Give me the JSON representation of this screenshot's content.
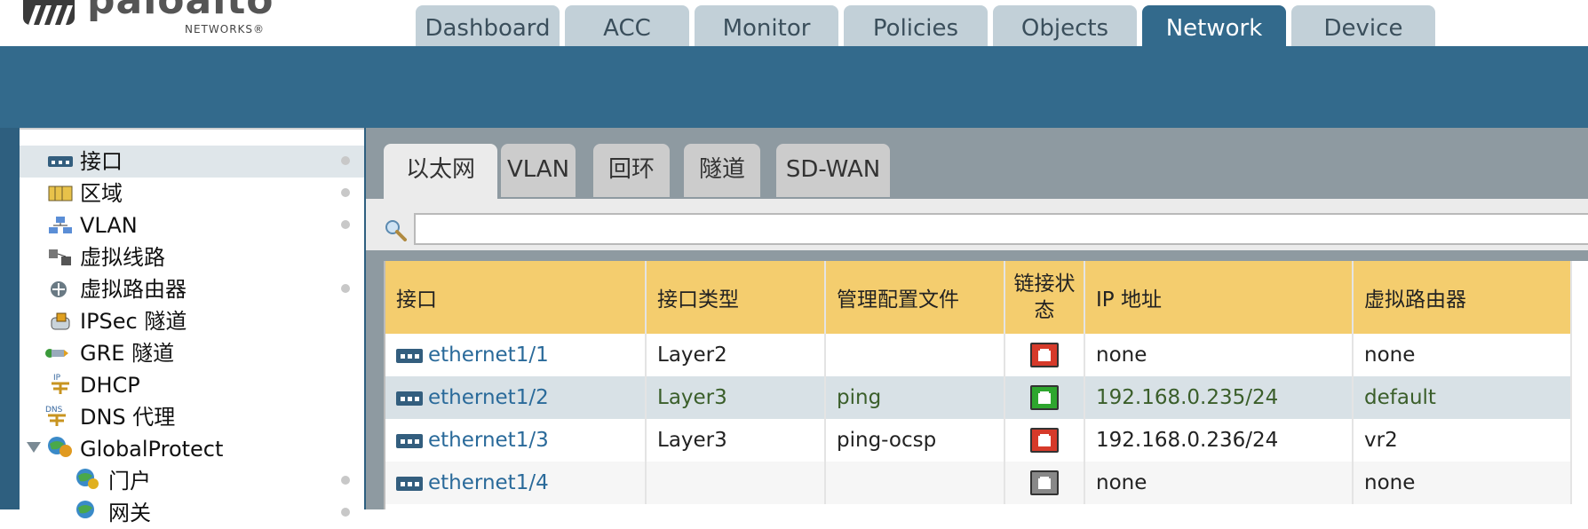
{
  "header": {
    "logo_text": "paloalto",
    "logo_sub": "NETWORKS®",
    "tabs": [
      {
        "label": "Dashboard",
        "active": false
      },
      {
        "label": "ACC",
        "active": false
      },
      {
        "label": "Monitor",
        "active": false
      },
      {
        "label": "Policies",
        "active": false
      },
      {
        "label": "Objects",
        "active": false
      },
      {
        "label": "Network",
        "active": true
      },
      {
        "label": "Device",
        "active": false
      }
    ]
  },
  "sidebar": {
    "items": [
      {
        "label": "接口",
        "icon": "interface-icon",
        "selected": true,
        "dot": true
      },
      {
        "label": "区域",
        "icon": "zone-icon",
        "selected": false,
        "dot": true
      },
      {
        "label": "VLAN",
        "icon": "vlan-icon",
        "selected": false,
        "dot": true
      },
      {
        "label": "虚拟线路",
        "icon": "virtual-wire-icon",
        "selected": false,
        "dot": false
      },
      {
        "label": "虚拟路由器",
        "icon": "virtual-router-icon",
        "selected": false,
        "dot": true
      },
      {
        "label": "IPSec 隧道",
        "icon": "ipsec-tunnel-icon",
        "selected": false,
        "dot": false
      },
      {
        "label": "GRE 隧道",
        "icon": "gre-tunnel-icon",
        "selected": false,
        "dot": false
      },
      {
        "label": "DHCP",
        "icon": "dhcp-icon",
        "selected": false,
        "dot": false
      },
      {
        "label": "DNS 代理",
        "icon": "dns-proxy-icon",
        "selected": false,
        "dot": false
      },
      {
        "label": "GlobalProtect",
        "icon": "globalprotect-icon",
        "selected": false,
        "dot": false,
        "expanded": true
      },
      {
        "label": "门户",
        "icon": "portal-icon",
        "selected": false,
        "dot": true
      },
      {
        "label": "网关",
        "icon": "gateway-icon",
        "selected": false,
        "dot": true
      }
    ]
  },
  "subtabs": [
    {
      "label": "以太网",
      "active": true
    },
    {
      "label": "VLAN",
      "active": false
    },
    {
      "label": "回环",
      "active": false
    },
    {
      "label": "隧道",
      "active": false
    },
    {
      "label": "SD-WAN",
      "active": false
    }
  ],
  "search": {
    "value": "",
    "placeholder": ""
  },
  "table": {
    "columns": [
      "接口",
      "接口类型",
      "管理配置文件",
      "链接状态",
      "IP 地址",
      "虚拟路由器"
    ],
    "rows": [
      {
        "interface": "ethernet1/1",
        "type": "Layer2",
        "profile": "",
        "link": "down",
        "ip": "none",
        "router": "none"
      },
      {
        "interface": "ethernet1/2",
        "type": "Layer3",
        "profile": "ping",
        "link": "up",
        "ip": "192.168.0.235/24",
        "router": "default"
      },
      {
        "interface": "ethernet1/3",
        "type": "Layer3",
        "profile": "ping-ocsp",
        "link": "down",
        "ip": "192.168.0.236/24",
        "router": "vr2"
      },
      {
        "interface": "ethernet1/4",
        "type": "",
        "profile": "",
        "link": "unknown",
        "ip": "none",
        "router": "none"
      }
    ]
  },
  "colors": {
    "header_blue": "#336a8c",
    "tab_inactive": "#c2d0d8",
    "table_header": "#f4cd6e",
    "link_up": "#2ea62e",
    "link_down": "#d63a2a",
    "link_unknown": "#888888",
    "interface_link": "#2a6a9a"
  }
}
